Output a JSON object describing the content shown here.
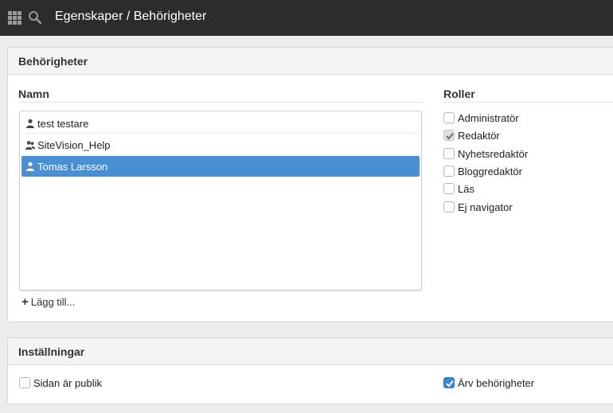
{
  "header": {
    "title": "Egenskaper / Behörigheter",
    "menu_icon": "apps-grid-icon",
    "search_icon": "search-icon"
  },
  "permissions": {
    "title": "Behörigheter",
    "names_heading": "Namn",
    "roles_heading": "Roller",
    "users": [
      {
        "name": "test testare",
        "icon": "user-icon",
        "selected": false
      },
      {
        "name": "SiteVision_Help",
        "icon": "user-group-icon",
        "selected": false
      },
      {
        "name": "Tomas Larsson",
        "icon": "user-icon",
        "selected": true
      }
    ],
    "add_label": "Lägg till...",
    "roles": [
      {
        "label": "Administratör",
        "checked": false
      },
      {
        "label": "Redaktör",
        "checked": true
      },
      {
        "label": "Nyhetsredaktör",
        "checked": false
      },
      {
        "label": "Bloggredaktör",
        "checked": false
      },
      {
        "label": "Läs",
        "checked": false
      },
      {
        "label": "Ej navigator",
        "checked": false
      }
    ]
  },
  "settings": {
    "title": "Inställningar",
    "public_label": "Sidan är publik",
    "public_checked": false,
    "inherit_label": "Ärv behörigheter",
    "inherit_checked": true
  },
  "colors": {
    "topbar": "#2c2c2c",
    "selection": "#4a8fd2",
    "checkbox_blue": "#3a87d8"
  }
}
